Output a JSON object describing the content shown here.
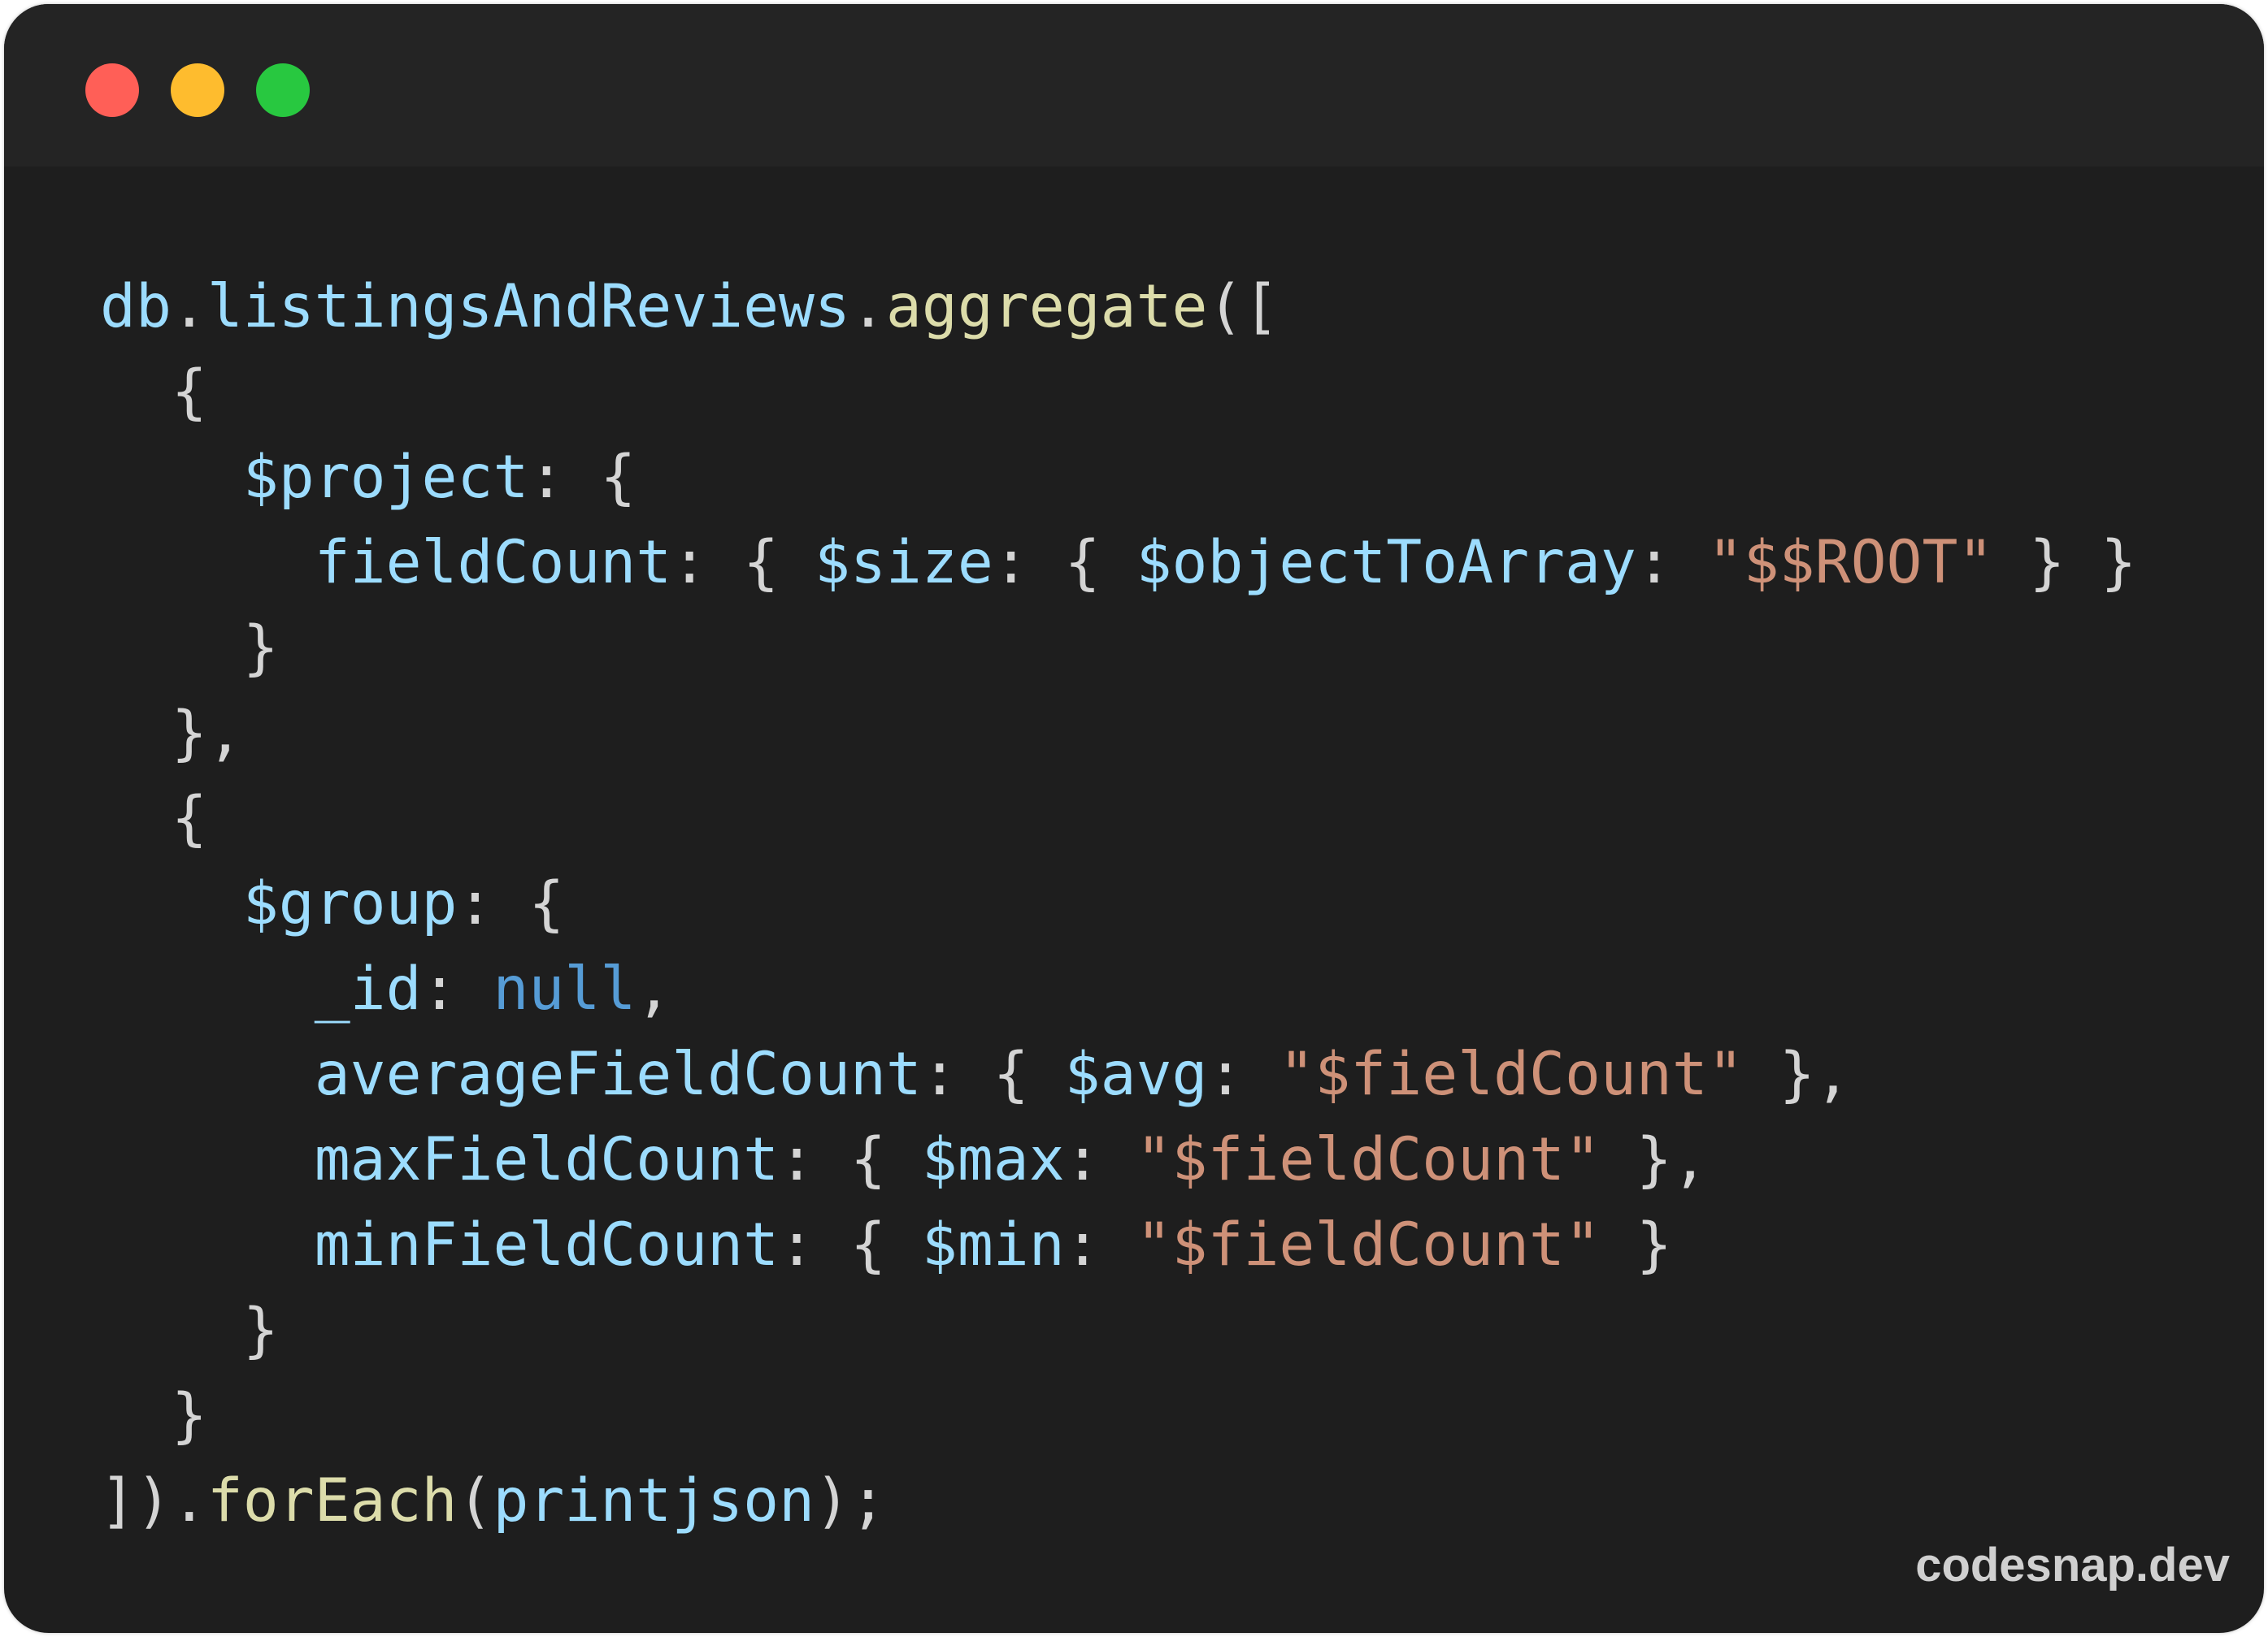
{
  "window": {
    "controls": [
      {
        "name": "close",
        "color": "#ff5f57"
      },
      {
        "name": "minimize",
        "color": "#febc2e"
      },
      {
        "name": "maximize",
        "color": "#28c840"
      }
    ]
  },
  "colors": {
    "background": "#1e1e1e",
    "titlebar": "#242424",
    "variable": "#9cdcfe",
    "function": "#dcdcaa",
    "string": "#ce9178",
    "keyword": "#569cd6",
    "punctuation": "#d4d4d4"
  },
  "code": {
    "language": "javascript",
    "lines": [
      [
        [
          "var",
          "db"
        ],
        [
          "p",
          "."
        ],
        [
          "var",
          "listingsAndReviews"
        ],
        [
          "p",
          "."
        ],
        [
          "fn",
          "aggregate"
        ],
        [
          "p",
          "(["
        ]
      ],
      [
        [
          "p",
          "  {"
        ]
      ],
      [
        [
          "p",
          "    "
        ],
        [
          "var",
          "$project"
        ],
        [
          "p",
          ": {"
        ]
      ],
      [
        [
          "p",
          "      "
        ],
        [
          "var",
          "fieldCount"
        ],
        [
          "p",
          ": { "
        ],
        [
          "var",
          "$size"
        ],
        [
          "p",
          ": { "
        ],
        [
          "var",
          "$objectToArray"
        ],
        [
          "p",
          ": "
        ],
        [
          "str",
          "\"$$ROOT\""
        ],
        [
          "p",
          " } }"
        ]
      ],
      [
        [
          "p",
          "    }"
        ]
      ],
      [
        [
          "p",
          "  },"
        ]
      ],
      [
        [
          "p",
          "  {"
        ]
      ],
      [
        [
          "p",
          "    "
        ],
        [
          "var",
          "$group"
        ],
        [
          "p",
          ": {"
        ]
      ],
      [
        [
          "p",
          "      "
        ],
        [
          "var",
          "_id"
        ],
        [
          "p",
          ": "
        ],
        [
          "kw",
          "null"
        ],
        [
          "p",
          ","
        ]
      ],
      [
        [
          "p",
          "      "
        ],
        [
          "var",
          "averageFieldCount"
        ],
        [
          "p",
          ": { "
        ],
        [
          "var",
          "$avg"
        ],
        [
          "p",
          ": "
        ],
        [
          "str",
          "\"$fieldCount\""
        ],
        [
          "p",
          " },"
        ]
      ],
      [
        [
          "p",
          "      "
        ],
        [
          "var",
          "maxFieldCount"
        ],
        [
          "p",
          ": { "
        ],
        [
          "var",
          "$max"
        ],
        [
          "p",
          ": "
        ],
        [
          "str",
          "\"$fieldCount\""
        ],
        [
          "p",
          " },"
        ]
      ],
      [
        [
          "p",
          "      "
        ],
        [
          "var",
          "minFieldCount"
        ],
        [
          "p",
          ": { "
        ],
        [
          "var",
          "$min"
        ],
        [
          "p",
          ": "
        ],
        [
          "str",
          "\"$fieldCount\""
        ],
        [
          "p",
          " }"
        ]
      ],
      [
        [
          "p",
          "    }"
        ]
      ],
      [
        [
          "p",
          "  }"
        ]
      ],
      [
        [
          "p",
          "])."
        ],
        [
          "fn",
          "forEach"
        ],
        [
          "p",
          "("
        ],
        [
          "var",
          "printjson"
        ],
        [
          "p",
          ");"
        ]
      ]
    ]
  },
  "watermark": "codesnap.dev"
}
